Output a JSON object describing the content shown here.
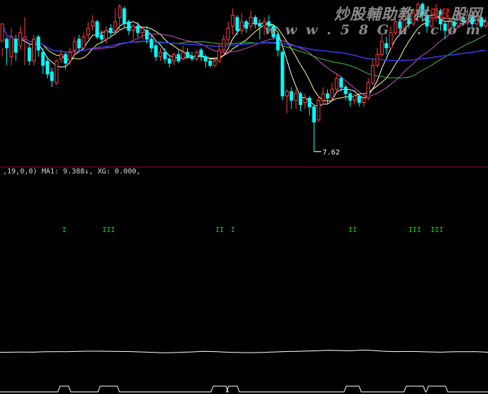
{
  "watermark": {
    "title_prefix": "炒股輔助教材",
    "title_number": "58",
    "title_suffix": "股网",
    "url": "w w w . 5 8 G u . c o m"
  },
  "status": {
    "params": ",19,0,0)",
    "text": " MA1: 9.388↓, XG: 0.000,"
  },
  "colors": {
    "background": "#000000",
    "up_candle": "#ff4040",
    "down_candle": "#00ffff",
    "ma_white": "#ffffff",
    "ma_yellow": "#ffff80",
    "ma_magenta": "#d050d0",
    "ma_green": "#40c040",
    "ma_blue": "#3a3af0",
    "signal": "#00e000",
    "separator": "#a01010",
    "line": "#ffffff"
  },
  "chart_data": [
    {
      "type": "candlestick",
      "min_label": "7.62",
      "min_value": 7.62,
      "ylim": [
        7.4,
        11.0
      ],
      "candles": [
        [
          10.15,
          10.55,
          10.0,
          9.8
        ],
        [
          10.2,
          10.0,
          10.25,
          9.6
        ],
        [
          9.8,
          10.25,
          10.45,
          9.6
        ],
        [
          10.2,
          9.9,
          10.3,
          9.7
        ],
        [
          10.05,
          10.35,
          10.5,
          9.95
        ],
        [
          10.2,
          10.25,
          10.7,
          9.6
        ],
        [
          10.0,
          9.7,
          10.1,
          9.6
        ],
        [
          9.7,
          10.2,
          10.3,
          9.6
        ],
        [
          10.25,
          9.95,
          10.3,
          9.8
        ],
        [
          9.9,
          9.6,
          10.0,
          9.4
        ],
        [
          9.7,
          9.4,
          9.8,
          9.3
        ],
        [
          9.45,
          9.25,
          9.55,
          9.1
        ],
        [
          9.2,
          9.7,
          9.75,
          9.15
        ],
        [
          9.75,
          9.85,
          9.95,
          9.65
        ],
        [
          9.85,
          9.65,
          9.9,
          9.5
        ],
        [
          9.7,
          9.9,
          10.0,
          9.6
        ],
        [
          9.95,
          10.15,
          10.25,
          9.85
        ],
        [
          10.2,
          10.0,
          10.3,
          9.9
        ],
        [
          10.0,
          10.25,
          10.35,
          9.95
        ],
        [
          10.3,
          10.45,
          10.6,
          10.2
        ],
        [
          10.5,
          10.6,
          10.75,
          10.4
        ],
        [
          10.6,
          10.25,
          10.65,
          10.2
        ],
        [
          10.3,
          10.2,
          10.4,
          10.1
        ],
        [
          10.2,
          10.4,
          10.5,
          10.1
        ],
        [
          10.45,
          10.35,
          10.55,
          10.25
        ],
        [
          10.4,
          10.6,
          10.9,
          10.3
        ],
        [
          10.7,
          10.95,
          11.0,
          10.4
        ],
        [
          10.9,
          10.55,
          10.95,
          10.45
        ],
        [
          10.6,
          10.4,
          10.65,
          10.3
        ],
        [
          10.4,
          10.5,
          10.55,
          10.2
        ],
        [
          10.5,
          10.35,
          10.6,
          10.25
        ],
        [
          10.35,
          10.45,
          10.5,
          10.2
        ],
        [
          10.4,
          10.2,
          10.5,
          10.1
        ],
        [
          10.2,
          10.0,
          10.3,
          9.9
        ],
        [
          10.05,
          9.8,
          10.1,
          9.7
        ],
        [
          9.8,
          9.9,
          10.0,
          9.7
        ],
        [
          9.9,
          9.75,
          10.0,
          9.65
        ],
        [
          9.75,
          9.65,
          9.8,
          9.55
        ],
        [
          9.7,
          9.85,
          9.9,
          9.6
        ],
        [
          9.85,
          9.7,
          9.95,
          9.65
        ],
        [
          9.75,
          9.9,
          10.05,
          9.7
        ],
        [
          9.9,
          9.8,
          10.0,
          9.75
        ],
        [
          9.8,
          9.75,
          9.9,
          9.7
        ],
        [
          9.75,
          9.9,
          9.95,
          9.7
        ],
        [
          9.95,
          9.8,
          10.0,
          9.7
        ],
        [
          9.8,
          9.7,
          9.85,
          9.55
        ],
        [
          9.7,
          9.6,
          9.75,
          9.55
        ],
        [
          9.6,
          9.7,
          9.75,
          9.55
        ],
        [
          9.7,
          9.95,
          10.1,
          9.65
        ],
        [
          9.95,
          10.2,
          10.3,
          9.9
        ],
        [
          10.2,
          10.45,
          10.6,
          10.1
        ],
        [
          10.5,
          10.75,
          10.9,
          10.3
        ],
        [
          10.7,
          10.4,
          10.75,
          10.3
        ],
        [
          10.4,
          10.6,
          10.8,
          10.3
        ],
        [
          10.6,
          10.45,
          10.65,
          10.35
        ],
        [
          10.5,
          10.7,
          10.85,
          10.4
        ],
        [
          10.7,
          10.55,
          10.75,
          10.45
        ],
        [
          10.55,
          10.5,
          10.65,
          10.2
        ],
        [
          10.5,
          10.6,
          10.7,
          10.3
        ],
        [
          10.6,
          10.5,
          10.75,
          10.4
        ],
        [
          10.5,
          10.25,
          10.55,
          10.2
        ],
        [
          10.3,
          9.95,
          10.35,
          9.8
        ],
        [
          9.9,
          8.9,
          9.95,
          8.8
        ],
        [
          8.9,
          9.0,
          9.05,
          8.5
        ],
        [
          9.0,
          8.8,
          9.1,
          8.6
        ],
        [
          8.8,
          8.95,
          9.05,
          8.6
        ],
        [
          8.95,
          8.7,
          9.0,
          8.55
        ],
        [
          8.75,
          8.85,
          8.95,
          8.6
        ],
        [
          8.85,
          8.65,
          8.9,
          8.45
        ],
        [
          8.65,
          8.3,
          8.7,
          7.62
        ],
        [
          8.35,
          8.8,
          8.9,
          8.3
        ],
        [
          8.8,
          8.95,
          9.1,
          8.7
        ],
        [
          8.95,
          8.85,
          9.05,
          8.7
        ],
        [
          8.85,
          9.05,
          9.2,
          8.8
        ],
        [
          9.05,
          9.3,
          9.4,
          8.95
        ],
        [
          9.3,
          9.1,
          9.35,
          9.0
        ],
        [
          9.1,
          8.95,
          9.15,
          8.8
        ],
        [
          8.95,
          8.8,
          9.0,
          8.65
        ],
        [
          8.8,
          8.9,
          8.95,
          8.7
        ],
        [
          8.9,
          8.75,
          8.95,
          8.65
        ],
        [
          8.75,
          8.85,
          8.9,
          8.65
        ],
        [
          8.85,
          9.2,
          9.3,
          8.8
        ],
        [
          9.2,
          9.6,
          9.75,
          9.15
        ],
        [
          9.6,
          9.85,
          10.0,
          9.55
        ],
        [
          9.85,
          10.15,
          10.3,
          9.8
        ],
        [
          10.1,
          10.0,
          10.25,
          9.85
        ],
        [
          10.0,
          10.35,
          10.5,
          9.95
        ],
        [
          10.35,
          10.6,
          10.75,
          10.3
        ],
        [
          10.6,
          10.45,
          10.65,
          10.35
        ],
        [
          10.45,
          10.75,
          10.85,
          10.4
        ],
        [
          10.75,
          10.55,
          10.8,
          10.45
        ],
        [
          10.55,
          10.8,
          10.9,
          10.5
        ],
        [
          10.8,
          11.0,
          11.05,
          10.6
        ],
        [
          11.0,
          10.75,
          11.05,
          10.6
        ],
        [
          10.75,
          10.5,
          10.8,
          10.35
        ],
        [
          10.5,
          10.7,
          10.85,
          10.45
        ],
        [
          10.7,
          10.85,
          11.0,
          10.6
        ],
        [
          10.85,
          10.55,
          10.9,
          10.4
        ],
        [
          10.55,
          10.4,
          10.6,
          10.2
        ],
        [
          10.4,
          10.6,
          10.7,
          10.35
        ],
        [
          10.6,
          10.5,
          10.75,
          10.4
        ],
        [
          10.5,
          10.7,
          10.85,
          10.45
        ],
        [
          10.7,
          10.6,
          10.75,
          10.5
        ],
        [
          10.6,
          10.75,
          10.9,
          10.5
        ],
        [
          10.75,
          10.55,
          10.8,
          10.45
        ],
        [
          10.55,
          10.7,
          10.8,
          10.5
        ],
        [
          10.7,
          10.5,
          10.75,
          10.45
        ],
        [
          10.5,
          10.6,
          10.7,
          10.45
        ]
      ]
    },
    {
      "type": "signal",
      "symbol": "I",
      "marks": [
        [
          14,
          1
        ],
        [
          24,
          3
        ],
        [
          49,
          2
        ],
        [
          52,
          1
        ],
        [
          79,
          2
        ],
        [
          93,
          3
        ],
        [
          98,
          3
        ]
      ]
    },
    {
      "type": "line",
      "values": [
        0.35,
        0.35,
        0.36,
        0.38,
        0.37,
        0.36,
        0.4,
        0.42,
        0.43,
        0.44,
        0.43,
        0.45,
        0.47,
        0.5,
        0.5,
        0.5,
        0.49,
        0.48,
        0.46,
        0.45,
        0.44,
        0.4,
        0.37,
        0.34,
        0.3,
        0.28,
        0.3,
        0.33,
        0.36,
        0.39,
        0.44,
        0.47,
        0.45,
        0.42,
        0.38,
        0.34,
        0.32,
        0.3,
        0.3,
        0.3,
        0.33,
        0.37,
        0.4,
        0.44,
        0.46,
        0.48,
        0.5,
        0.52,
        0.55,
        0.6,
        0.62,
        0.6,
        0.58,
        0.55,
        0.6,
        0.65,
        0.62,
        0.58,
        0.5,
        0.46,
        0.44,
        0.45,
        0.46,
        0.45,
        0.42,
        0.4,
        0.38,
        0.36,
        0.4,
        0.42,
        0.43,
        0.42,
        0.44,
        0.4,
        0.35
      ]
    },
    {
      "type": "bar",
      "baseline_value": 0,
      "marks": [
        [
          14,
          1
        ],
        [
          24,
          3
        ],
        [
          49,
          2
        ],
        [
          52,
          1
        ],
        [
          79,
          2
        ],
        [
          93,
          3
        ],
        [
          98,
          3
        ]
      ]
    }
  ]
}
